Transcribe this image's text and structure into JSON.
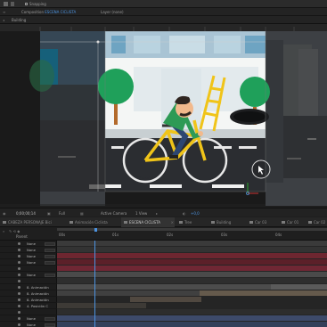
{
  "topbar": {
    "snapping_label": "Snapping"
  },
  "panels": {
    "composition_prefix": "Composition",
    "composition_name": "ESCENA CICLISTA",
    "layer_label": "Layer (none)"
  },
  "breadcrumb": {
    "item": "Building"
  },
  "viewer_controls": {
    "timecode": "0;00;00;14",
    "resolution": "Full",
    "camera": "Active Camera",
    "views": "1 View",
    "exposure": "+0,0"
  },
  "timeline_tabs": [
    {
      "label": "CABEZA PERSONAJE Bici",
      "active": false
    },
    {
      "label": "Animación Ciclista",
      "active": false
    },
    {
      "label": "ESCENA CICLISTA",
      "active": true
    },
    {
      "label": "Tree",
      "active": false
    },
    {
      "label": "Building",
      "active": false
    },
    {
      "label": "Car 03",
      "active": false
    },
    {
      "label": "Car 01",
      "active": false
    },
    {
      "label": "Car 02",
      "active": false
    }
  ],
  "timeline_header": {
    "parent_label": "Parent"
  },
  "ruler_marks": [
    "00s",
    "01s",
    "02s",
    "03s",
    "04s"
  ],
  "layers": [
    {
      "num": "",
      "label": "None"
    },
    {
      "num": "",
      "label": "None"
    },
    {
      "num": "",
      "label": "None"
    },
    {
      "num": "",
      "label": "None"
    },
    {
      "num": "",
      "label": ""
    },
    {
      "num": "",
      "label": "None"
    },
    {
      "num": "",
      "label": ""
    },
    {
      "num": "",
      "label": "8. Animación"
    },
    {
      "num": "",
      "label": "8. Animación"
    },
    {
      "num": "",
      "label": "8. Animación"
    },
    {
      "num": "",
      "label": "4. Posición C"
    },
    {
      "num": "",
      "label": ""
    },
    {
      "num": "",
      "label": "None"
    },
    {
      "num": "",
      "label": "None"
    }
  ],
  "colors": {
    "timeline_bar_red": "#6e2630",
    "timeline_bar_gray": "#4a4a4a",
    "timeline_bar_tan": "#655a4c",
    "timeline_bar_blue": "#3d4a6a",
    "playhead": "#4c93e0",
    "shirt": "#2e9a55",
    "bike_frame": "#f0c419",
    "tree": "#1fa05a",
    "sky": "#e9f1f5"
  }
}
